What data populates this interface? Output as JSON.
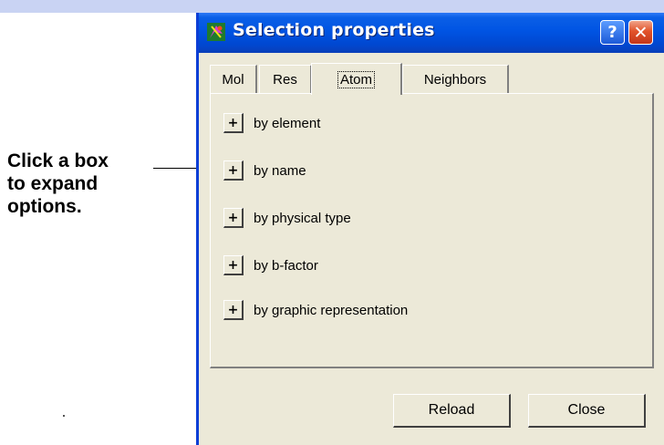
{
  "annotation": {
    "lines": [
      "Click a box",
      "to expand",
      "options."
    ]
  },
  "window": {
    "title": "Selection properties",
    "help_glyph": "?",
    "close_glyph": "✕"
  },
  "tabs": [
    {
      "label": "Mol",
      "active": false
    },
    {
      "label": "Res",
      "active": false
    },
    {
      "label": "Atom",
      "active": true
    },
    {
      "label": "Neighbors",
      "active": false
    }
  ],
  "options": [
    {
      "expander": "+",
      "label": "by element"
    },
    {
      "expander": "+",
      "label": "by name"
    },
    {
      "expander": "+",
      "label": "by physical type"
    },
    {
      "expander": "+",
      "label": "by b-factor"
    },
    {
      "expander": "+",
      "label": "by graphic representation"
    }
  ],
  "buttons": {
    "reload": "Reload",
    "close": "Close"
  },
  "colors": {
    "titlebar": "#0054e3",
    "dialog_face": "#ece9d8",
    "top_band": "#c9d3f3",
    "close_button": "#e2532a"
  }
}
